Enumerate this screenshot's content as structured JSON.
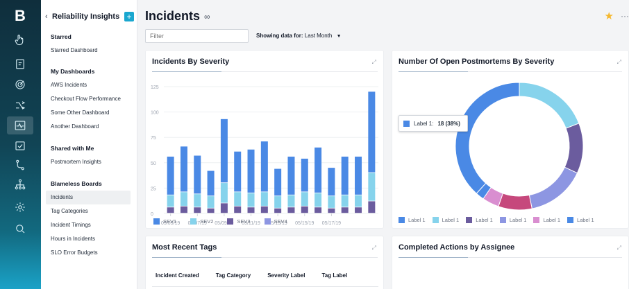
{
  "rail": {
    "logo": "B",
    "icons": [
      "hand-icon",
      "clipboard-icon",
      "target-icon",
      "merge-icon",
      "activity-icon",
      "checkbox-icon",
      "git-icon",
      "network-icon",
      "settings-icon",
      "search-icon"
    ]
  },
  "sidebar": {
    "back_icon": "‹",
    "title": "Reliability Insights",
    "add_label": "+",
    "sections": [
      {
        "heading": "Starred",
        "items": [
          "Starred Dashboard"
        ]
      },
      {
        "heading": "My Dashboards",
        "items": [
          "AWS Incidents",
          "Checkout Flow Performance",
          "Some Other Dashboard",
          "Another Dashboard"
        ]
      },
      {
        "heading": "Shared with Me",
        "items": [
          "Postmortem Insights"
        ]
      },
      {
        "heading": "Blameless Boards",
        "items": [
          "Incidents",
          "Tag Categories",
          "Incident Timings",
          "Hours in Incidents",
          "SLO Error Budgets"
        ]
      }
    ],
    "active_item": "Incidents"
  },
  "header": {
    "title": "Incidents",
    "glasses_icon": "∞",
    "star_icon": "★",
    "more_icon": "···",
    "filter_placeholder": "Filter",
    "showing_label": "Showing data for:",
    "showing_value": "Last Month"
  },
  "cards": {
    "severity": {
      "title": "Incidents By Severity",
      "expand_icon": "⤢"
    },
    "postmortems": {
      "title": "Number Of Open Postmortems By Severity",
      "expand_icon": "⤢"
    },
    "tags": {
      "title": "Most Recent Tags",
      "expand_icon": "⤢",
      "columns": [
        "Incident Created",
        "Tag Category",
        "Severity Label",
        "Tag Label"
      ]
    },
    "actions": {
      "title": "Completed Actions by Assignee",
      "expand_icon": "⤢"
    }
  },
  "tooltip": {
    "label": "Label 1:",
    "value": "18 (38%)"
  },
  "chart_data": [
    {
      "type": "bar",
      "stacked": true,
      "title": "Incidents By Severity",
      "ylim": [
        0,
        125
      ],
      "yticks": [
        0,
        25,
        50,
        75,
        100,
        125
      ],
      "xtick_labels": [
        "05/05/19",
        "05/07/19",
        "05/09/19",
        "05/11/19",
        "05/13/19",
        "05/15/19",
        "05/17/19"
      ],
      "categories": [
        "05/05/19",
        "05/06/19",
        "05/07/19",
        "05/08/19",
        "05/09/19",
        "05/10/19",
        "05/11/19",
        "05/12/19",
        "05/13/19",
        "05/14/19",
        "05/15/19",
        "05/16/19",
        "05/17/19",
        "05/18/19",
        "05/19/19",
        "05/20/19"
      ],
      "series": [
        {
          "name": "SEV1",
          "color": "#4a89e5",
          "values": [
            38,
            45,
            38,
            25,
            63,
            40,
            43,
            50,
            27,
            38,
            33,
            45,
            28,
            38,
            38,
            80
          ]
        },
        {
          "name": "SEV2",
          "color": "#86d3ec",
          "values": [
            12,
            14,
            13,
            12,
            20,
            14,
            14,
            14,
            12,
            12,
            14,
            14,
            12,
            12,
            12,
            28
          ]
        },
        {
          "name": "SEV3",
          "color": "#6b5c9e",
          "values": [
            6,
            7,
            6,
            5,
            10,
            7,
            6,
            7,
            5,
            6,
            7,
            6,
            5,
            6,
            6,
            12
          ]
        },
        {
          "name": "SEV4",
          "color": "#8d96e2",
          "values": [
            0,
            0,
            0,
            0,
            0,
            0,
            0,
            0,
            0,
            0,
            0,
            0,
            0,
            0,
            0,
            0
          ]
        }
      ]
    },
    {
      "type": "pie",
      "donut": true,
      "title": "Number Of Open Postmortems By Severity",
      "slices": [
        {
          "label": "Label 1",
          "value": 18,
          "color": "#4a89e5"
        },
        {
          "label": "Label 1",
          "value": 9,
          "color": "#86d3ec"
        },
        {
          "label": "Label 1",
          "value": 6,
          "color": "#6b5c9e"
        },
        {
          "label": "Label 1",
          "value": 7,
          "color": "#8d96e2"
        },
        {
          "label": "Label 1",
          "value": 4,
          "color": "#c6487c"
        },
        {
          "label": "Label 1",
          "value": 2,
          "color": "#d98ed0"
        },
        {
          "label": "Label 1",
          "value": 1,
          "color": "#4a89e5"
        }
      ],
      "legend_colors": [
        "#4a89e5",
        "#86d3ec",
        "#6b5c9e",
        "#8d96e2",
        "#d98ed0",
        "#4a89e5"
      ],
      "legend_labels": [
        "Label 1",
        "Label 1",
        "Label 1",
        "Label 1",
        "Label 1",
        "Label 1"
      ]
    }
  ]
}
